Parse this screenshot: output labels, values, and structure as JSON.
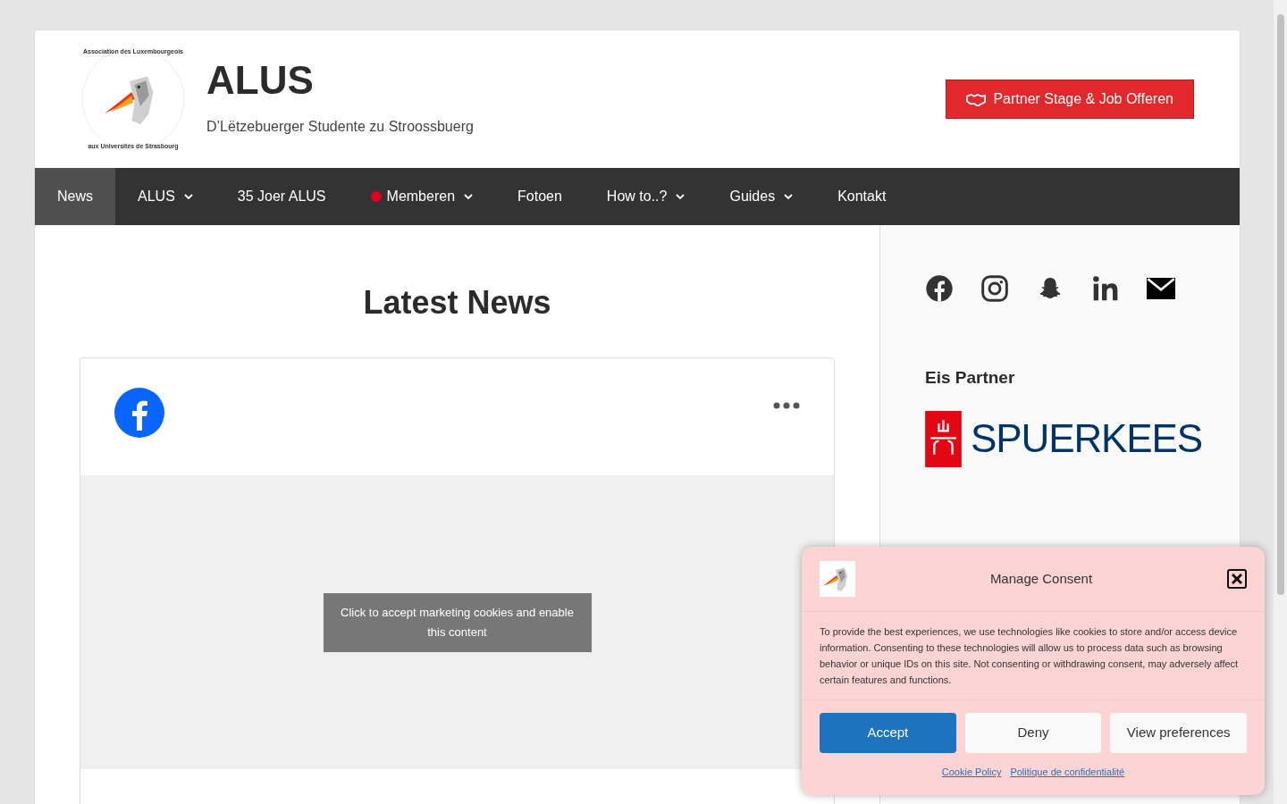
{
  "header": {
    "logo_ring_top": "Association des Luxembourgeois",
    "logo_ring_bottom": "aux Universités de Strasbourg",
    "title": "ALUS",
    "tagline": "D’Lëtzebuerger Studente zu Stroossbuerg",
    "partner_button": "Partner Stage & Job Offeren"
  },
  "nav": [
    {
      "label": "News",
      "selected": true,
      "dropdown": false
    },
    {
      "label": "ALUS",
      "selected": false,
      "dropdown": true
    },
    {
      "label": "35 Joer ALUS",
      "selected": false,
      "dropdown": false
    },
    {
      "label": "Memberen",
      "selected": false,
      "dropdown": true,
      "color": "#e3001b"
    },
    {
      "label": "Fotoen",
      "selected": false,
      "dropdown": false
    },
    {
      "label": "How to..?",
      "selected": false,
      "dropdown": true
    },
    {
      "label": "Guides",
      "selected": false,
      "dropdown": true
    },
    {
      "label": "Kontakt",
      "selected": false,
      "dropdown": false
    }
  ],
  "main": {
    "heading": "Latest News",
    "embed": {
      "notice": "Click to accept marketing cookies and enable this content"
    }
  },
  "sidebar": {
    "partner_heading": "Eis Partner",
    "partner_logo_text": "SPUERKEES"
  },
  "consent": {
    "title": "Manage Consent",
    "body": "To provide the best experiences, we use technologies like cookies to store and/or access device information. Consenting to these technologies will allow us to process data such as browsing behavior or unique IDs on this site. Not consenting or withdrawing consent, may adversely affect certain features and functions.",
    "buttons": [
      {
        "label": "Accept",
        "kind": "primary"
      },
      {
        "label": "Deny",
        "kind": "plain"
      },
      {
        "label": "View preferences",
        "kind": "plain"
      }
    ],
    "links": [
      "Cookie Policy",
      "Politique de confidentialité"
    ]
  }
}
